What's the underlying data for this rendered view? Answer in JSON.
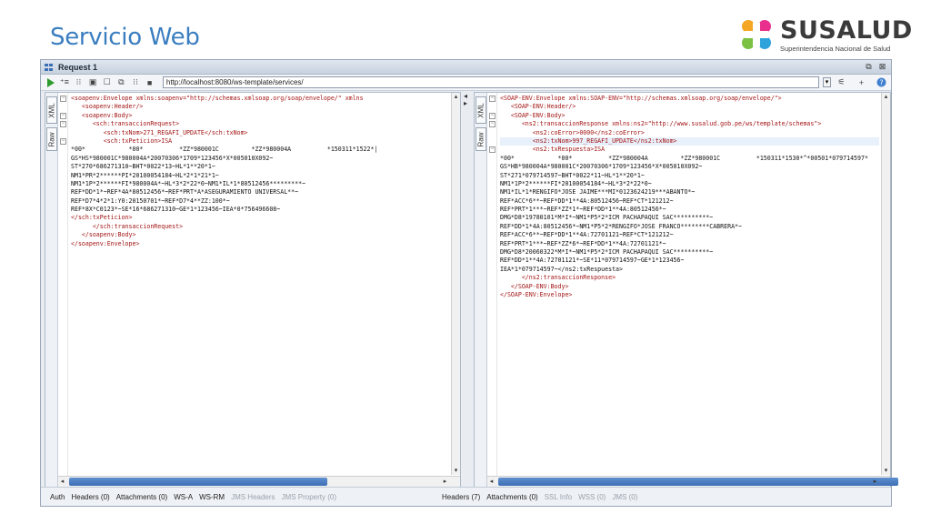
{
  "slide": {
    "title": "Servicio Web",
    "logo_name": "SUSALUD",
    "logo_subtitle": "Superintendencia Nacional de Salud",
    "logo_colors": [
      "#f5a623",
      "#e8308c",
      "#7bc143",
      "#2fa3dc"
    ]
  },
  "window": {
    "title": "Request 1",
    "endpoint_url": "http://localhost:8080/ws-template/services/"
  },
  "left_pane": {
    "side_tabs": [
      "XML",
      "Raw"
    ],
    "lines": [
      "<soapenv:Envelope xmlns:soapenv=\"http://schemas.xmlsoap.org/soap/envelope/\" xmlns",
      "   <soapenv:Header/>",
      "   <soapenv:Body>",
      "      <sch:transaccionRequest>",
      "         <sch:txNom>271_REGAFI_UPDATE</sch:txNom>",
      "         <sch:txPeticion>ISA",
      "*00*            *00*          *ZZ*980001C         *ZZ*980004A          *150311*1522*|",
      "GS*HS*980001C*980004A*20070306*1709*123456*X*005010X092~",
      "ST*270*686271310~BHT*0022*13~HL*1**20*1~",
      "NM1*PR*2******PI*20100054184~HL*2*1*21*1~",
      "NM1*1P*2******FI*980004A*~HL*3*2*22*0~NM1*IL*1*80512456*********~",
      "REF*DD*1*~REF*4A*80512456*~REF*PRT*A*ASEGURAMIENTO UNIVERSAL**~",
      "REF*D7*4*2*1:Y0:20150701*~REF*D7*4**ZZ:100*~",
      "REF*8X*C0123*~SE*16*686271310~GE*1*123456~IEA*0*756496608~",
      "</sch:txPeticion>",
      "      </sch:transaccionRequest>",
      "   </soapenv:Body>",
      "</soapenv:Envelope>"
    ]
  },
  "right_pane": {
    "side_tabs": [
      "XML",
      "Raw"
    ],
    "lines": [
      "<SOAP-ENV:Envelope xmlns:SOAP-ENV=\"http://schemas.xmlsoap.org/soap/envelope/\">",
      "   <SOAP-ENV:Header/>",
      "   <SOAP-ENV:Body>",
      "      <ns2:transaccionResponse xmlns:ns2=\"http://www.susalud.gob.pe/ws/template/schemas\">",
      "         <ns2:coError>0000</ns2:coError>",
      "         <ns2:txNom>997_REGAFI_UPDATE</ns2:txNom>",
      "         <ns2:txRespuesta>ISA",
      "*00*            *00*          *ZZ*980004A         *ZZ*980001C          *150311*1530*^*00501*079714597*",
      "GS*HB*980004A*980001C*20070306*1709*123456*X*005010X092~",
      "ST*271*079714597~BHT*0022*11~HL*1**20*1~",
      "NM1*1P*2******FI*20100054184*~HL*3*2*22*0~",
      "NM1*IL*1*RENGIFO*JOSE JAIME***MI*0123624219***ABANTO*~",
      "REF*ACC*6**~REF*DD*1**4A:80512456~REF*CT*121212~",
      "REF*PRT*1***~REF*ZZ*1*~REF*DD*1**4A:80512456*~",
      "DMG*D8*19780101*M*I*~NM1*P5*2*ICM PACHAPAQUI SAC**********~",
      "REF*DD*1*4A:80512456*~NM1*P5*2*RENGIFO*JOSE FRANCO********CABRERA*~",
      "REF*ACC*6**~REF*DD*1**4A:72701121~REF*CT*121212~",
      "REF*PRT*1***~REF*ZZ*6*~REF*DD*1**4A:72701121*~",
      "DMG*D8*20060322*M*I*~NM1*P5*2*ICM PACHAPAQUI SAC**********~",
      "REF*DD*1**4A:72701121*~SE*11*079714597~GE*1*123456~",
      "IEA*1*079714597~</ns2:txRespuesta>",
      "      </ns2:transaccionResponse>",
      "   </SOAP-ENV:Body>",
      "</SOAP-ENV:Envelope>"
    ]
  },
  "bottom_tabs_left": [
    {
      "label": "Auth",
      "enabled": true
    },
    {
      "label": "Headers (0)",
      "enabled": true
    },
    {
      "label": "Attachments (0)",
      "enabled": true
    },
    {
      "label": "WS-A",
      "enabled": true
    },
    {
      "label": "WS-RM",
      "enabled": true
    },
    {
      "label": "JMS Headers",
      "enabled": false
    },
    {
      "label": "JMS Property (0)",
      "enabled": false
    }
  ],
  "bottom_tabs_right": [
    {
      "label": "Headers (7)",
      "enabled": true
    },
    {
      "label": "Attachments (0)",
      "enabled": true
    },
    {
      "label": "SSL Info",
      "enabled": false
    },
    {
      "label": "WSS (0)",
      "enabled": false
    },
    {
      "label": "JMS (0)",
      "enabled": false
    }
  ]
}
